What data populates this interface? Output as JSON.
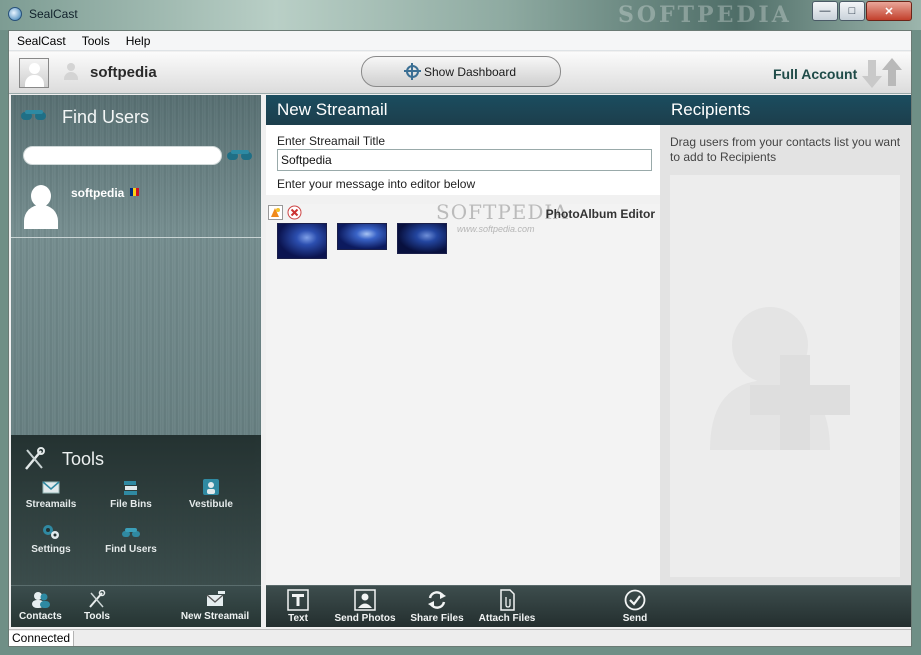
{
  "window": {
    "title": "SealCast",
    "watermark": "SOFTPEDIA",
    "min_glyph": "—",
    "max_glyph": "□",
    "close_glyph": "✕"
  },
  "menu": {
    "items": [
      "SealCast",
      "Tools",
      "Help"
    ]
  },
  "header": {
    "username": "softpedia",
    "dashboard_button": "Show Dashboard",
    "account_label": "Full Account"
  },
  "find_users": {
    "title": "Find Users",
    "search_value": "",
    "results": [
      {
        "name": "softpedia",
        "flag_colors": [
          "#002b7f",
          "#fcd116",
          "#ce1126"
        ]
      }
    ]
  },
  "tools": {
    "title": "Tools",
    "items": [
      "Streamails",
      "File Bins",
      "Vestibule",
      "Settings",
      "Find Users"
    ]
  },
  "left_tabs": [
    "Contacts",
    "Tools",
    "New Streamail"
  ],
  "streamail": {
    "header": "New Streamail",
    "title_label": "Enter Streamail Title",
    "title_value": "Softpedia",
    "editor_hint": "Enter your message into editor below",
    "photo_editor_label": "PhotoAlbum Editor",
    "watermark": "SOFTPEDIA",
    "watermark_small": "www.softpedia.com",
    "thumbnails": [
      {
        "colors": [
          "#0b1450",
          "#2c4fb0",
          "#7fa0e8"
        ]
      },
      {
        "colors": [
          "#0c1a5e",
          "#3a64c8",
          "#a8c4f4"
        ]
      },
      {
        "colors": [
          "#08103e",
          "#2346a0",
          "#6f8fd8"
        ]
      }
    ]
  },
  "recipients": {
    "header": "Recipients",
    "hint": "Drag users from your contacts list you want to add to Recipients"
  },
  "compose_toolbar": [
    "Text",
    "Send Photos",
    "Share Files",
    "Attach Files",
    "Send"
  ],
  "status": {
    "text": "Connected"
  },
  "colors": {
    "panel_header": "#1b4d5f",
    "accent_teal": "#1f4b48",
    "tool_icon": "#2e8aa3"
  }
}
